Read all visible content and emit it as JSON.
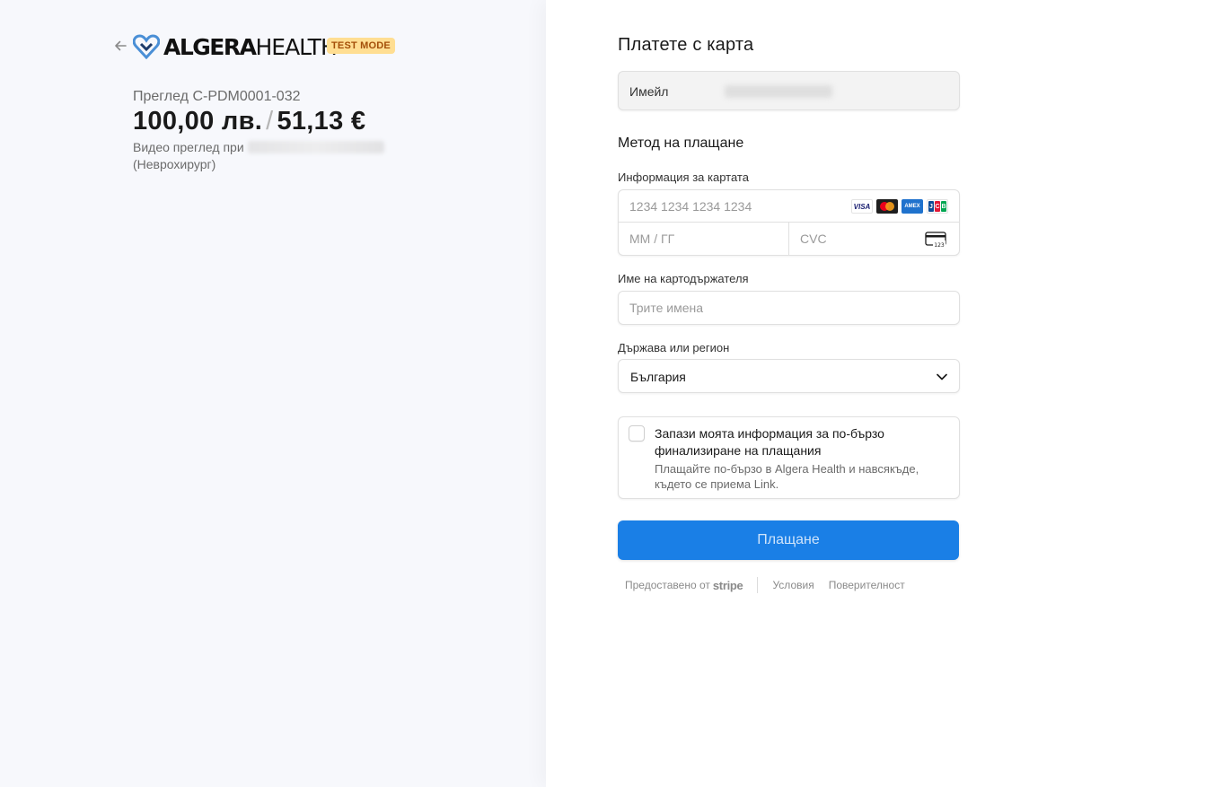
{
  "merchant": {
    "logo_bold": "ALGERA",
    "logo_thin": "HEALTH",
    "test_mode_label": "TEST MODE",
    "logo_color": "#4a8fd6"
  },
  "product": {
    "name": "Преглед C-PDM0001-032",
    "price_bgn": "100,00 лв.",
    "price_separator": "/",
    "price_eur": "51,13 €",
    "description_prefix": "Видео преглед при",
    "description_suffix": "(Неврохирург)"
  },
  "form": {
    "title": "Платете с карта",
    "email_label": "Имейл",
    "payment_method_title": "Метод на плащане",
    "card_info_label": "Информация за картата",
    "card_number_placeholder": "1234 1234 1234 1234",
    "expiry_placeholder": "ММ / ГГ",
    "cvc_placeholder": "CVC",
    "card_brands": [
      "VISA",
      "MC",
      "AMEX",
      "JCB"
    ],
    "cardholder_label": "Име на картодържателя",
    "cardholder_placeholder": "Трите имена",
    "country_label": "Държава или регион",
    "country_value": "България",
    "save_info_title": "Запази моята информация за по-бързо финализиране на плащания",
    "save_info_desc": "Плащайте по-бързо в Algera Health и навсякъде, където се приема Link.",
    "pay_button": "Плащане",
    "pay_button_color": "#1a7fe6"
  },
  "footer": {
    "powered_by": "Предоставено от",
    "stripe": "stripe",
    "terms": "Условия",
    "privacy": "Поверителност"
  }
}
